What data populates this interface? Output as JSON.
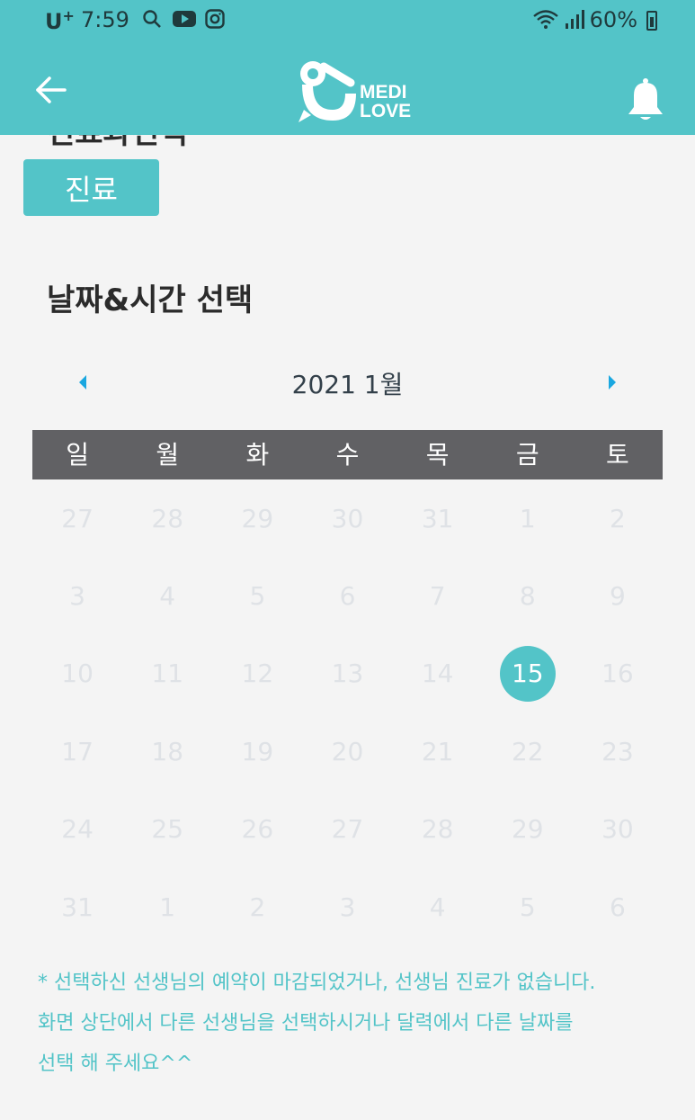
{
  "status_bar": {
    "carrier": "U",
    "carrier_sup": "+",
    "time": "7:59",
    "battery": "60%",
    "icons": [
      "search-icon",
      "youtube-icon",
      "instagram-icon",
      "wifi-icon",
      "signal-icon",
      "battery-icon"
    ]
  },
  "header": {
    "logo_line1": "MEDI",
    "logo_line2": "LOVE",
    "back_icon": "arrow-left-icon",
    "bell_icon": "bell-icon",
    "accent_color": "#53c4c8"
  },
  "department": {
    "label": "진료"
  },
  "section": {
    "title": "날짜&시간 선택"
  },
  "calendar": {
    "month_label": "2021 1월",
    "weekdays": [
      "일",
      "월",
      "화",
      "수",
      "목",
      "금",
      "토"
    ],
    "weeks": [
      [
        "27",
        "28",
        "29",
        "30",
        "31",
        "1",
        "2"
      ],
      [
        "3",
        "4",
        "5",
        "6",
        "7",
        "8",
        "9"
      ],
      [
        "10",
        "11",
        "12",
        "13",
        "14",
        "15",
        "16"
      ],
      [
        "17",
        "18",
        "19",
        "20",
        "21",
        "22",
        "23"
      ],
      [
        "24",
        "25",
        "26",
        "27",
        "28",
        "29",
        "30"
      ],
      [
        "31",
        "1",
        "2",
        "3",
        "4",
        "5",
        "6"
      ]
    ],
    "selected_day": "15"
  },
  "notice": {
    "line1": "* 선택하신 선생님의 예약이 마감되었거나, 선생님 진료가 없습니다.",
    "line2": "화면 상단에서 다른 선생님을 선택하시거나 달력에서 다른 날짜를",
    "line3": "선택 해 주세요^^"
  }
}
